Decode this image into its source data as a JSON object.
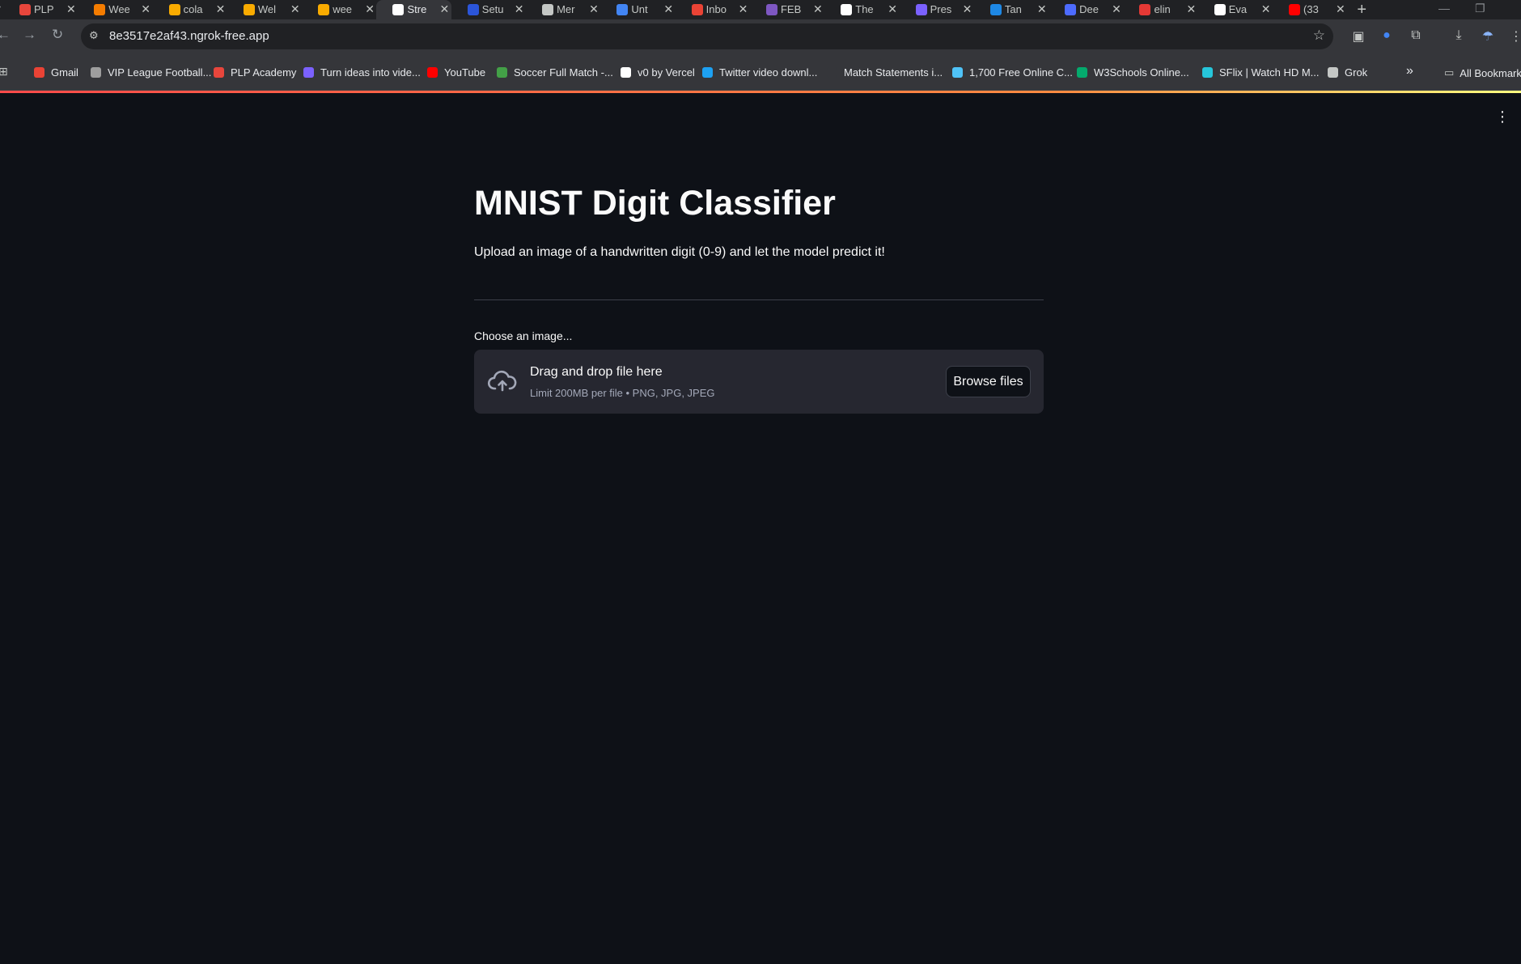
{
  "browser": {
    "tabs": [
      {
        "title": "PLP",
        "favicon_color": "#e8463c",
        "active": false
      },
      {
        "title": "Wee",
        "favicon_color": "#f57c00",
        "active": false
      },
      {
        "title": "cola",
        "favicon_color": "#f9ab00",
        "active": false
      },
      {
        "title": "Wel",
        "favicon_color": "#f9ab00",
        "active": false
      },
      {
        "title": "wee",
        "favicon_color": "#f9ab00",
        "active": false
      },
      {
        "title": "Stre",
        "favicon_color": "#ffffff",
        "active": true
      },
      {
        "title": "Setu",
        "favicon_color": "#2b55d9",
        "active": false
      },
      {
        "title": "Mer",
        "favicon_color": "#c4c7c5",
        "active": false
      },
      {
        "title": "Unt",
        "favicon_color": "#4285f4",
        "active": false
      },
      {
        "title": "Inbo",
        "favicon_color": "#ea4335",
        "active": false
      },
      {
        "title": "FEB",
        "favicon_color": "#7e57c2",
        "active": false
      },
      {
        "title": "The",
        "favicon_color": "#ffffff",
        "active": false
      },
      {
        "title": "Pres",
        "favicon_color": "#7b61ff",
        "active": false
      },
      {
        "title": "Tan",
        "favicon_color": "#1e88e5",
        "active": false
      },
      {
        "title": "Dee",
        "favicon_color": "#4d6bfe",
        "active": false
      },
      {
        "title": "elin",
        "favicon_color": "#e53935",
        "active": false
      },
      {
        "title": "Eva",
        "favicon_color": "#ffffff",
        "active": false
      },
      {
        "title": "(33",
        "favicon_color": "#ff0000",
        "active": false
      }
    ],
    "new_tab_label": "+",
    "url": "8e3517e2af43.ngrok-free.app",
    "bookmarks": [
      {
        "label": "Gmail",
        "icon_color": "#ea4335"
      },
      {
        "label": "VIP League Football...",
        "icon_color": "#9e9e9e"
      },
      {
        "label": "PLP Academy",
        "icon_color": "#e8463c"
      },
      {
        "label": "Turn ideas into vide...",
        "icon_color": "#7b61ff"
      },
      {
        "label": "YouTube",
        "icon_color": "#ff0000"
      },
      {
        "label": "Soccer Full Match -...",
        "icon_color": "#43a047"
      },
      {
        "label": "v0 by Vercel",
        "icon_color": "#ffffff"
      },
      {
        "label": "Twitter video downl...",
        "icon_color": "#1da1f2"
      },
      {
        "label": "Match Statements i...",
        "icon_color": "#35363a"
      },
      {
        "label": "1,700 Free Online C...",
        "icon_color": "#4fc3f7"
      },
      {
        "label": "W3Schools Online...",
        "icon_color": "#04aa6d"
      },
      {
        "label": "SFlix | Watch HD M...",
        "icon_color": "#26c6da"
      },
      {
        "label": "Grok",
        "icon_color": "#c4c7c5"
      }
    ],
    "more_bookmarks_label": "»",
    "all_bookmarks_label": "All Bookmarks"
  },
  "app": {
    "title": "MNIST Digit Classifier",
    "subtitle": "Upload an image of a handwritten digit (0-9) and let the model predict it!",
    "uploader": {
      "label": "Choose an image...",
      "drop_text": "Drag and drop file here",
      "limit_text": "Limit 200MB per file • PNG, JPG, JPEG",
      "button_label": "Browse files"
    }
  },
  "colors": {
    "page_background": "#0e1117",
    "dropzone_background": "#262730",
    "text": "#fafafa",
    "muted_text": "#a3a8b8",
    "accent": "#ff4b4b"
  }
}
